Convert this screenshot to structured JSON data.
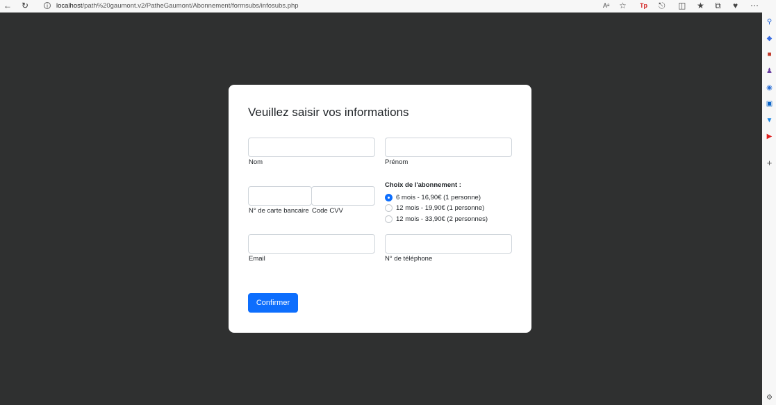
{
  "browser": {
    "url_host": "localhost",
    "url_path": "/path%20gaumont.v2/PatheGaumont/Abonnement/formsubs/infosubs.php",
    "icons": [
      "back-icon",
      "refresh-icon",
      "info-icon",
      "read-aloud-icon",
      "favorite-icon",
      "tp-extension-icon",
      "extensions-icon",
      "split-screen-icon",
      "favorites-icon",
      "collections-icon",
      "browser-essentials-icon",
      "more-icon",
      "copilot-icon"
    ]
  },
  "sidebar": {
    "icons": [
      "search-icon",
      "shopping-icon",
      "tools-icon",
      "games-icon",
      "office-icon",
      "outlook-icon",
      "drop-icon",
      "youtube-icon",
      "add-icon",
      "settings-icon"
    ]
  },
  "form": {
    "title": "Veuillez saisir vos informations",
    "fields": {
      "nom_label": "Nom",
      "prenom_label": "Prénom",
      "card_label": "N° de carte bancaire",
      "cvv_label": "Code CVV",
      "email_label": "Email",
      "phone_label": "N° de téléphone"
    },
    "subscription": {
      "title": "Choix de l'abonnement :",
      "options": [
        {
          "label": "6 mois - 16,90€ (1 personne)",
          "checked": true
        },
        {
          "label": "12 mois - 19,90€ (1 personne)",
          "checked": false
        },
        {
          "label": "12 mois - 33,90€ (2 personnes)",
          "checked": false
        }
      ]
    },
    "submit_label": "Confirmer"
  },
  "colors": {
    "accent": "#0d6efd",
    "page_background": "#2f3030",
    "card_background": "#ffffff"
  }
}
